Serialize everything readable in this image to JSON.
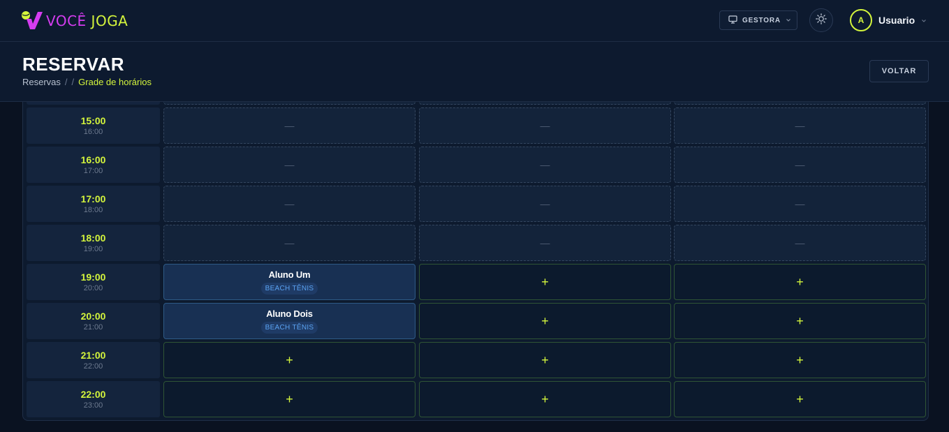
{
  "app": {
    "logo_word1": "VOCÊ",
    "logo_word2": "JOGA",
    "profile_label": "GESTORA",
    "avatar_initial": "A",
    "user_name": "Usuario",
    "colors": {
      "accent": "#d4f53c",
      "brand": "#d53cf0",
      "background": "#0a1221"
    }
  },
  "header": {
    "title": "RESERVAR",
    "breadcrumb": [
      "Reservas",
      "/",
      "/",
      "Grade de horários"
    ],
    "back_label": "VOLTAR"
  },
  "grid": {
    "rows": [
      {
        "start": "15:00",
        "end": "16:00",
        "slots": [
          {
            "state": "unavailable",
            "label": "—"
          },
          {
            "state": "unavailable",
            "label": "—"
          },
          {
            "state": "unavailable",
            "label": "—"
          }
        ]
      },
      {
        "start": "16:00",
        "end": "17:00",
        "slots": [
          {
            "state": "unavailable",
            "label": "—"
          },
          {
            "state": "unavailable",
            "label": "—"
          },
          {
            "state": "unavailable",
            "label": "—"
          }
        ]
      },
      {
        "start": "17:00",
        "end": "18:00",
        "slots": [
          {
            "state": "unavailable",
            "label": "—"
          },
          {
            "state": "unavailable",
            "label": "—"
          },
          {
            "state": "unavailable",
            "label": "—"
          }
        ]
      },
      {
        "start": "18:00",
        "end": "19:00",
        "slots": [
          {
            "state": "unavailable",
            "label": "—"
          },
          {
            "state": "unavailable",
            "label": "—"
          },
          {
            "state": "unavailable",
            "label": "—"
          }
        ]
      },
      {
        "start": "19:00",
        "end": "20:00",
        "slots": [
          {
            "state": "booked",
            "name": "Aluno Um",
            "tag": "BEACH TÊNIS"
          },
          {
            "state": "free",
            "label": "+"
          },
          {
            "state": "free",
            "label": "+"
          }
        ]
      },
      {
        "start": "20:00",
        "end": "21:00",
        "slots": [
          {
            "state": "booked",
            "name": "Aluno Dois",
            "tag": "BEACH TÊNIS"
          },
          {
            "state": "free",
            "label": "+"
          },
          {
            "state": "free",
            "label": "+"
          }
        ]
      },
      {
        "start": "21:00",
        "end": "22:00",
        "slots": [
          {
            "state": "free",
            "label": "+"
          },
          {
            "state": "free",
            "label": "+"
          },
          {
            "state": "free",
            "label": "+"
          }
        ]
      },
      {
        "start": "22:00",
        "end": "23:00",
        "slots": [
          {
            "state": "free",
            "label": "+"
          },
          {
            "state": "free",
            "label": "+"
          },
          {
            "state": "free",
            "label": "+"
          }
        ]
      }
    ]
  }
}
